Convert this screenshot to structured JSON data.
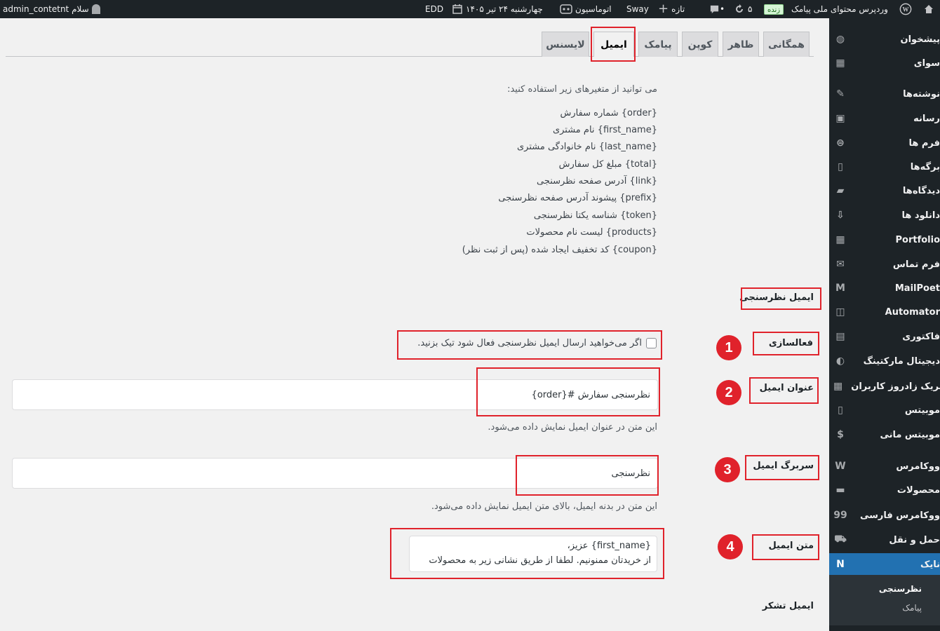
{
  "admin_bar": {
    "greeting": "سلام admin_contetnt",
    "site_name": "وردپرس محتوای ملی پیامک",
    "live_badge": "زنده",
    "updates_count": "۵",
    "new_label": "تازه",
    "sway_label": "Sway",
    "automation_label": "اتوماسیون",
    "date_label": "چهارشنبه ۲۴ تیر ۱۴۰۵",
    "edd_label": "EDD"
  },
  "sidebar": {
    "items": [
      {
        "label": "پیشخوان",
        "icon": "dashboard-icon"
      },
      {
        "label": "سوای",
        "icon": "grid-icon"
      },
      {
        "label": "نوشته‌ها",
        "icon": "pin-icon"
      },
      {
        "label": "رسانه",
        "icon": "media-icon"
      },
      {
        "label": "فرم ها",
        "icon": "form-icon"
      },
      {
        "label": "برگه‌ها",
        "icon": "page-icon"
      },
      {
        "label": "دیدگاه‌ها",
        "icon": "comment-icon"
      },
      {
        "label": "دانلود ها",
        "icon": "download-icon"
      },
      {
        "label": "Portfolio",
        "icon": "portfolio-icon"
      },
      {
        "label": "فرم تماس",
        "icon": "mail-icon"
      },
      {
        "label": "MailPoet",
        "icon": "mailpoet-icon"
      },
      {
        "label": "Automator",
        "icon": "automator-icon"
      },
      {
        "label": "فاکتوری",
        "icon": "invoice-icon"
      },
      {
        "label": "دیجیتال مارکتینگ",
        "icon": "megaphone-icon"
      },
      {
        "label": "تبریک زادروز کاربران",
        "icon": "calendar-icon"
      },
      {
        "label": "موبیتس",
        "icon": "phone-icon"
      },
      {
        "label": "موبیتس مانی",
        "icon": "dollar-icon"
      },
      {
        "label": "ووکامرس",
        "icon": "woo-icon"
      },
      {
        "label": "محصولات",
        "icon": "archive-icon"
      },
      {
        "label": "ووکامرس فارسی",
        "icon": "woo-fa-icon"
      },
      {
        "label": "حمل و نقل",
        "icon": "truck-icon"
      },
      {
        "label": "نایک",
        "icon": "nike-icon"
      }
    ],
    "submenu": [
      "نظرسنجی",
      "پیامک"
    ]
  },
  "tabs": [
    "همگانی",
    "ظاهر",
    "کوپن",
    "پیامک",
    "ایمیل",
    "لایسنس"
  ],
  "variables": {
    "intro": "می توانید از متغیرهای زیر استفاده کنید:",
    "lines": [
      "{order} شماره سفارش",
      "{first_name} نام مشتری",
      "{last_name} نام خانوادگی مشتری",
      "{total} مبلغ کل سفارش",
      "{link} آدرس صفحه نظرسنجی",
      "{prefix} پیشوند آدرس صفحه نظرسنجی",
      "{token} شناسه یکتا نظرسنجی",
      "{products} لیست نام محصولات",
      "{coupon} کد تخفیف ایجاد شده (پس از ثبت نظر)"
    ]
  },
  "survey_email": {
    "section_title": "ایمیل نظرسنجی",
    "activation_label": "فعالسازی",
    "activation_checkbox_text": "اگر می‌خواهید ارسال ایمیل نظرسنجی فعال شود تیک بزنید.",
    "subject_label": "عنوان ایمیل",
    "subject_value": "نظرسنجی سفارش #{order}",
    "subject_desc": "این متن در عنوان ایمیل نمایش داده می‌شود.",
    "header_label": "سربرگ ایمیل",
    "header_value": "نظرسنجی",
    "header_desc": "این متن در بدنه ایمیل، بالای متن ایمیل نمایش داده می‌شود.",
    "body_label": "متن ایمیل",
    "body_line1": "{first_name} عزیز،",
    "body_line2": "از خریدتان ممنونیم. لطفا از طریق نشانی زیر به محصولات"
  },
  "thanks_email": {
    "section_title": "ایمیل تشکر"
  },
  "badges": [
    "1",
    "2",
    "3",
    "4"
  ]
}
